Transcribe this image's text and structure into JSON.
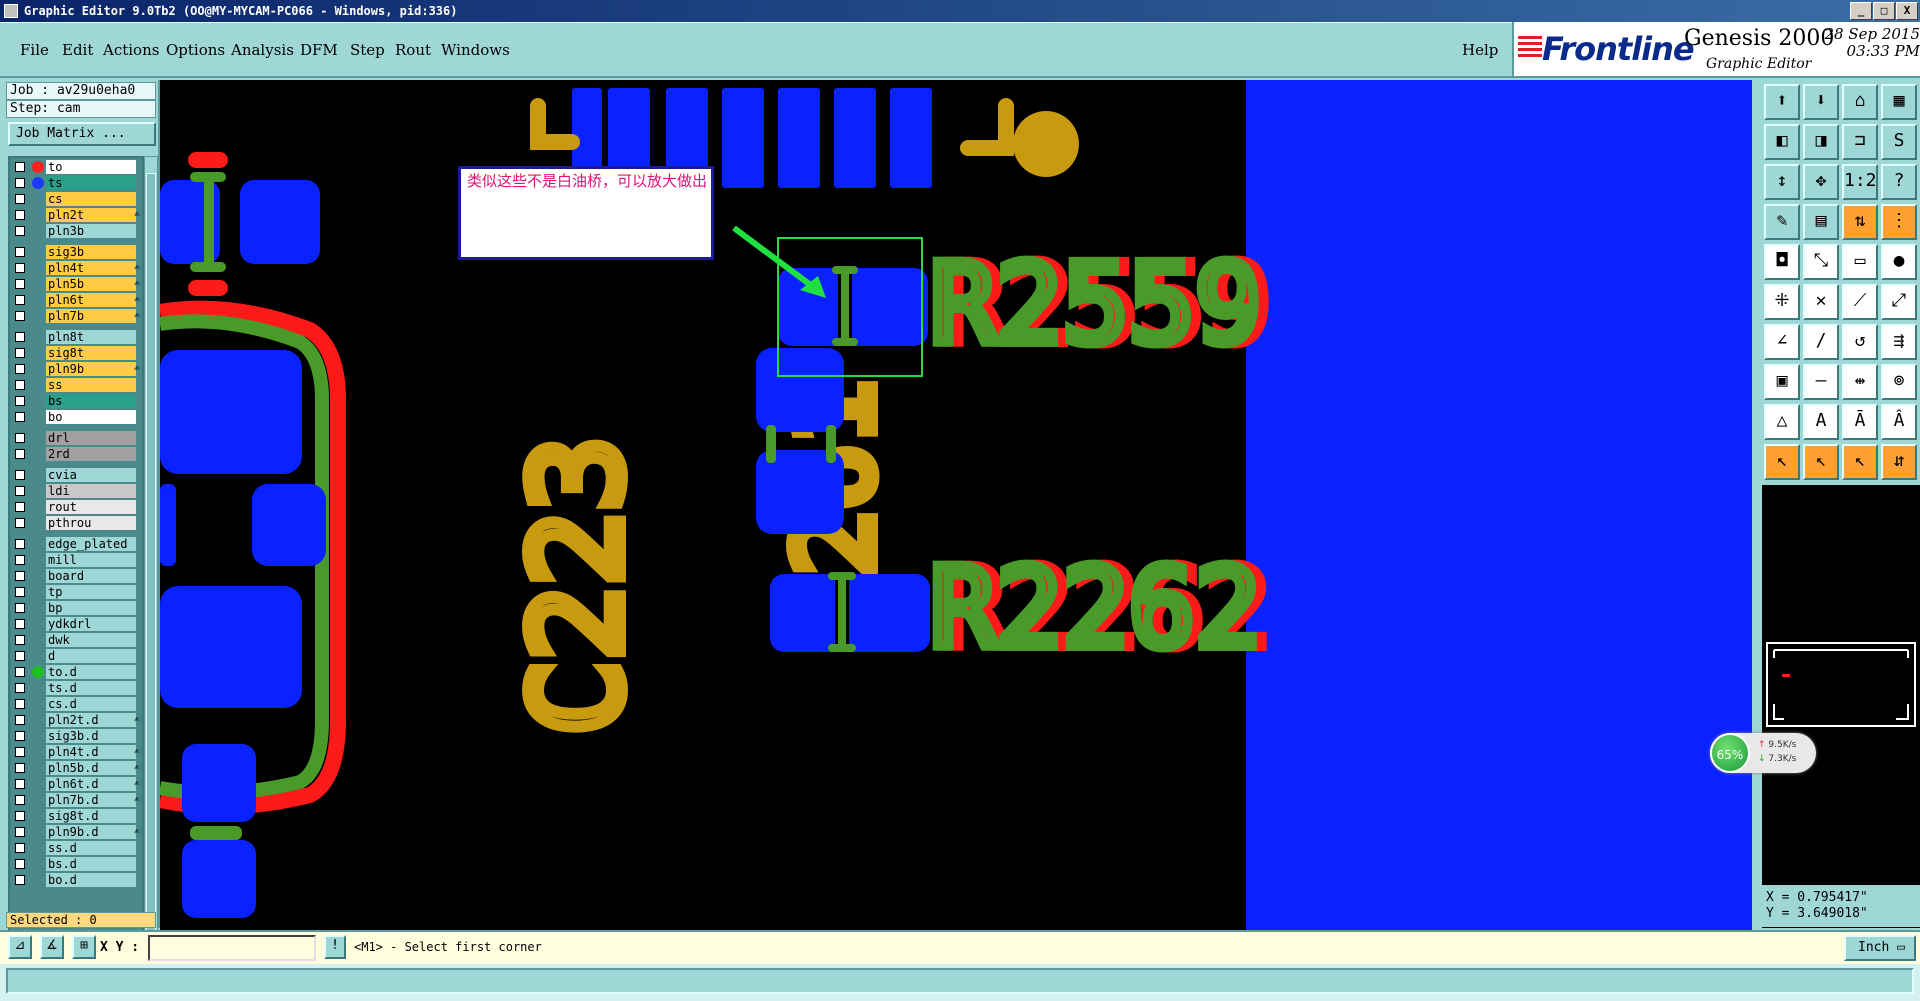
{
  "window": {
    "title": "Graphic Editor 9.0Tb2 (OO@MY-MYCAM-PC066 - Windows, pid:336)",
    "minimize": "_",
    "maximize": "□",
    "close": "X"
  },
  "menu": {
    "items": [
      "File",
      "Edit",
      "Actions",
      "Options",
      "Analysis",
      "DFM",
      "Step",
      "Rout",
      "Windows"
    ],
    "help": "Help"
  },
  "brand": {
    "logo": "Frontline",
    "product": "Genesis 2000",
    "subtitle": "Graphic Editor",
    "date": "28 Sep 2015",
    "time": "03:33 PM"
  },
  "job": {
    "job_label": "Job : av29u0eha0",
    "step_label": "Step: cam",
    "matrix_button": "Job Matrix ..."
  },
  "layers": [
    {
      "name": "to",
      "color": "#ffffff",
      "dot": "#ff2020"
    },
    {
      "name": "ts",
      "color": "#2aa08a",
      "dot": "#1a3aff"
    },
    {
      "name": "cs",
      "color": "#ffcc44"
    },
    {
      "name": "pln2t",
      "color": "#ffcc44",
      "mark": "✍"
    },
    {
      "name": "pln3b",
      "color": "#9fd6d6"
    },
    {
      "name": "sig3b",
      "color": "#ffcc44"
    },
    {
      "name": "pln4t",
      "color": "#ffcc44",
      "mark": "✍"
    },
    {
      "name": "pln5b",
      "color": "#ffcc44",
      "mark": "✍"
    },
    {
      "name": "pln6t",
      "color": "#ffcc44",
      "mark": "✍"
    },
    {
      "name": "pln7b",
      "color": "#ffcc44",
      "mark": "✍"
    },
    {
      "name": "pln8t",
      "color": "#9fd6d6"
    },
    {
      "name": "sig8t",
      "color": "#ffcc44"
    },
    {
      "name": "pln9b",
      "color": "#ffcc44",
      "mark": "✍"
    },
    {
      "name": "ss",
      "color": "#ffcc44"
    },
    {
      "name": "bs",
      "color": "#2aa08a"
    },
    {
      "name": "bo",
      "color": "#ffffff"
    },
    {
      "name": "drl",
      "color": "#a0a0a0"
    },
    {
      "name": "2rd",
      "color": "#a0a0a0"
    },
    {
      "name": "cvia",
      "color": "#9fd6d6"
    },
    {
      "name": "ldi",
      "color": "#c8c8c8"
    },
    {
      "name": "rout",
      "color": "#e8e8e8"
    },
    {
      "name": "pthrou",
      "color": "#e8e8e8"
    },
    {
      "name": "edge_plated",
      "color": "#9fd6d6"
    },
    {
      "name": "mill",
      "color": "#9fd6d6"
    },
    {
      "name": "board",
      "color": "#9fd6d6"
    },
    {
      "name": "tp",
      "color": "#9fd6d6"
    },
    {
      "name": "bp",
      "color": "#9fd6d6"
    },
    {
      "name": "ydkdrl",
      "color": "#9fd6d6"
    },
    {
      "name": "dwk",
      "color": "#9fd6d6"
    },
    {
      "name": "d",
      "color": "#9fd6d6"
    },
    {
      "name": "to.d",
      "color": "#9fd6d6",
      "dot": "#20c020"
    },
    {
      "name": "ts.d",
      "color": "#9fd6d6"
    },
    {
      "name": "cs.d",
      "color": "#9fd6d6"
    },
    {
      "name": "pln2t.d",
      "color": "#9fd6d6",
      "mark": "✍"
    },
    {
      "name": "sig3b.d",
      "color": "#9fd6d6"
    },
    {
      "name": "pln4t.d",
      "color": "#9fd6d6",
      "mark": "✍"
    },
    {
      "name": "pln5b.d",
      "color": "#9fd6d6",
      "mark": "✍"
    },
    {
      "name": "pln6t.d",
      "color": "#9fd6d6",
      "mark": "✍"
    },
    {
      "name": "pln7b.d",
      "color": "#9fd6d6",
      "mark": "✍"
    },
    {
      "name": "sig8t.d",
      "color": "#9fd6d6"
    },
    {
      "name": "pln9b.d",
      "color": "#9fd6d6",
      "mark": "✍"
    },
    {
      "name": "ss.d",
      "color": "#9fd6d6"
    },
    {
      "name": "bs.d",
      "color": "#9fd6d6"
    },
    {
      "name": "bo.d",
      "color": "#9fd6d6"
    }
  ],
  "selected_label": "Selected : 0",
  "canvas": {
    "labels": [
      "R2559",
      "R2262",
      "R261",
      "C223"
    ],
    "annotation": "类似这些不是白油桥，可以放大做出"
  },
  "tools": [
    {
      "icon": "open-icon",
      "glyph": "⬆"
    },
    {
      "icon": "save-icon",
      "glyph": "⬇"
    },
    {
      "icon": "home-icon",
      "glyph": "⌂"
    },
    {
      "icon": "layout-icon",
      "glyph": "▦"
    },
    {
      "icon": "zoom-left-icon",
      "glyph": "◧"
    },
    {
      "icon": "zoom-right-icon",
      "glyph": "◨"
    },
    {
      "icon": "snap-icon",
      "glyph": "⊐"
    },
    {
      "icon": "s-route-icon",
      "glyph": "S"
    },
    {
      "icon": "fit-height-icon",
      "glyph": "↕"
    },
    {
      "icon": "fit-all-icon",
      "glyph": "✥"
    },
    {
      "icon": "scale-icon",
      "glyph": "1:2"
    },
    {
      "icon": "query-icon",
      "glyph": "?"
    },
    {
      "icon": "measure-icon",
      "glyph": "✎"
    },
    {
      "icon": "grid-icon",
      "glyph": "▤"
    },
    {
      "icon": "net-icon",
      "glyph": "⇅",
      "style": "orange"
    },
    {
      "icon": "connect-icon",
      "glyph": "⋮",
      "style": "orange"
    },
    {
      "icon": "pad-icon",
      "glyph": "◘",
      "style": "white"
    },
    {
      "icon": "move-icon",
      "glyph": "⤡",
      "style": "white"
    },
    {
      "icon": "ruler-icon",
      "glyph": "▭",
      "style": "white"
    },
    {
      "icon": "circle-icon",
      "glyph": "●",
      "style": "white"
    },
    {
      "icon": "node-icon",
      "glyph": "⁜",
      "style": "white"
    },
    {
      "icon": "cross-icon",
      "glyph": "✕",
      "style": "white"
    },
    {
      "icon": "line-icon",
      "glyph": "⟋",
      "style": "white"
    },
    {
      "icon": "link-icon",
      "glyph": "⤢",
      "style": "white"
    },
    {
      "icon": "angle-icon",
      "glyph": "∠",
      "style": "white"
    },
    {
      "icon": "slash-icon",
      "glyph": "/",
      "style": "white"
    },
    {
      "icon": "arc-icon",
      "glyph": "↺",
      "style": "white"
    },
    {
      "icon": "split-icon",
      "glyph": "⇶",
      "style": "white"
    },
    {
      "icon": "rect-icon",
      "glyph": "▣",
      "style": "white"
    },
    {
      "icon": "minus-icon",
      "glyph": "—",
      "style": "white"
    },
    {
      "icon": "width-icon",
      "glyph": "⇹",
      "style": "white"
    },
    {
      "icon": "via-icon",
      "glyph": "⊚",
      "style": "white"
    },
    {
      "icon": "triangle-icon",
      "glyph": "△",
      "style": "white"
    },
    {
      "icon": "triangle-a-icon",
      "glyph": "A",
      "style": "white"
    },
    {
      "icon": "triangle-b-icon",
      "glyph": "Ā",
      "style": "white"
    },
    {
      "icon": "triangle-c-icon",
      "glyph": "Â",
      "style": "white"
    },
    {
      "icon": "pointer-icon",
      "glyph": "↖",
      "style": "orange"
    },
    {
      "icon": "pointer-select-icon",
      "glyph": "↖",
      "style": "orange"
    },
    {
      "icon": "pointer-area-icon",
      "glyph": "↖",
      "style": "orange"
    },
    {
      "icon": "route-icon",
      "glyph": "⇵",
      "style": "orange"
    }
  ],
  "coordinates": {
    "x": "X = 0.795417\"",
    "y": "Y = 3.649018\""
  },
  "net_meter": {
    "percent": "65%",
    "up": "9.5K/s",
    "down": "7.3K/s"
  },
  "command": {
    "xy_label": "X Y :",
    "xy_value": "",
    "prompt": "<M1> - Select first corner",
    "unit": "Inch"
  }
}
